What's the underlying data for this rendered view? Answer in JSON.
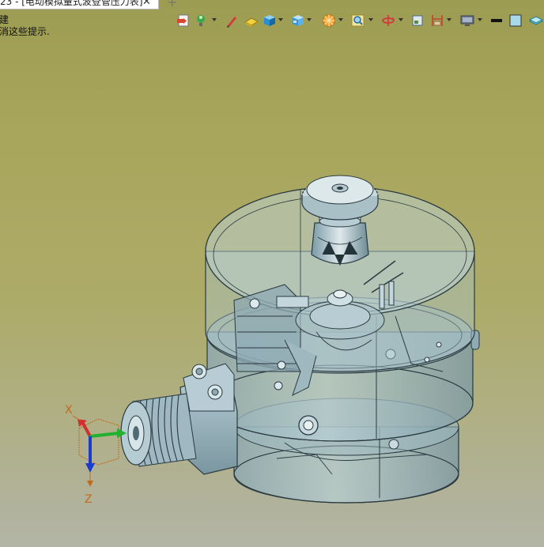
{
  "window": {
    "tab_title": "23 - [电动模拟量式波登管压力表]",
    "tab_close": "✕",
    "new_tab": "+"
  },
  "prompt": {
    "line1": "建",
    "line2": "消这些提示."
  },
  "toolbar": {
    "icons": [
      "import-icon",
      "light-icon",
      "pen-icon",
      "fill-icon",
      "cube-icon",
      "view-cube-icon",
      "render-icon",
      "zoom-icon",
      "rotate-icon",
      "window-icon",
      "dimension-icon",
      "display-icon",
      "line-style-icon",
      "color-swatch-icon",
      "layer-icon"
    ]
  },
  "triad": {
    "x_label": "X",
    "z_label": "Z"
  },
  "colors": {
    "background_top": "#9c9c52",
    "background_bottom": "#b2b4a6",
    "model_body": "#a9c4cc",
    "model_edge": "#2a3a40"
  }
}
